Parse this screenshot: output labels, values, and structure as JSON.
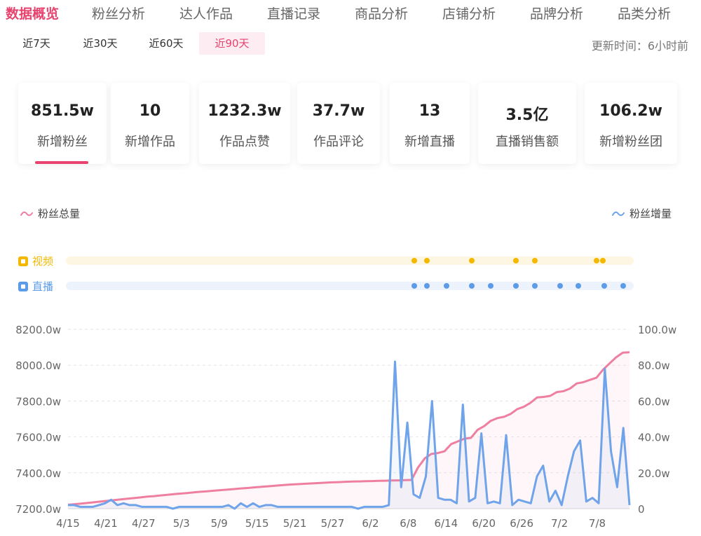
{
  "nav": {
    "tabs": [
      {
        "label": "数据概览",
        "active": true
      },
      {
        "label": "粉丝分析"
      },
      {
        "label": "达人作品"
      },
      {
        "label": "直播记录"
      },
      {
        "label": "商品分析"
      },
      {
        "label": "店铺分析"
      },
      {
        "label": "品牌分析"
      },
      {
        "label": "品类分析"
      }
    ]
  },
  "range": {
    "buttons": [
      "近7天",
      "近30天",
      "近60天",
      "近90天"
    ],
    "selected": "近90天"
  },
  "update_time": "更新时间：6小时前",
  "stats": [
    {
      "value": "851.5w",
      "label": "新增粉丝",
      "selected": true
    },
    {
      "value": "10",
      "label": "新增作品"
    },
    {
      "value": "1232.3w",
      "label": "作品点赞"
    },
    {
      "value": "37.7w",
      "label": "作品评论"
    },
    {
      "value": "13",
      "label": "新增直播"
    },
    {
      "value": "3.5亿",
      "label": "直播销售额"
    },
    {
      "value": "106.2w",
      "label": "新增粉丝团"
    }
  ],
  "legend": {
    "left": "粉丝总量",
    "right": "粉丝增量"
  },
  "tracks": {
    "video": {
      "label": "视频",
      "color": "#f5b800",
      "bar_color": "#fdf6e3"
    },
    "live": {
      "label": "直播",
      "color": "#5b9be8",
      "bar_color": "#edf3fc"
    }
  },
  "colors": {
    "accent": "#e8436f",
    "pink_line": "#ef7fa0",
    "blue_line": "#6fa3ea"
  },
  "chart_data": {
    "type": "line",
    "x_ticks": [
      "4/15",
      "4/21",
      "4/27",
      "5/3",
      "5/9",
      "5/15",
      "5/21",
      "5/27",
      "6/2",
      "6/8",
      "6/14",
      "6/20",
      "6/26",
      "7/2",
      "7/8"
    ],
    "y_left": {
      "ticks": [
        "7200.0w",
        "7400.0w",
        "7600.0w",
        "7800.0w",
        "8000.0w",
        "8200.0w"
      ],
      "min": 7200,
      "max": 8200
    },
    "y_right": {
      "ticks": [
        "0",
        "20.0w",
        "40.0w",
        "60.0w",
        "80.0w",
        "100.0w"
      ],
      "min": 0,
      "max": 100
    },
    "series": [
      {
        "name": "粉丝总量",
        "axis": "left",
        "values": [
          7222,
          7225,
          7228,
          7232,
          7236,
          7240,
          7244,
          7248,
          7252,
          7256,
          7259,
          7263,
          7267,
          7270,
          7274,
          7277,
          7281,
          7284,
          7287,
          7291,
          7294,
          7297,
          7300,
          7303,
          7306,
          7309,
          7312,
          7315,
          7318,
          7321,
          7324,
          7327,
          7330,
          7333,
          7335,
          7337,
          7339,
          7341,
          7343,
          7345,
          7347,
          7348,
          7350,
          7351,
          7352,
          7353,
          7354,
          7355,
          7356,
          7357,
          7358,
          7359,
          7360,
          7430,
          7480,
          7505,
          7510,
          7520,
          7560,
          7575,
          7590,
          7595,
          7640,
          7660,
          7690,
          7705,
          7712,
          7728,
          7755,
          7768,
          7790,
          7820,
          7823,
          7829,
          7850,
          7855,
          7870,
          7898,
          7905,
          7918,
          7930,
          7975,
          8010,
          8045,
          8070,
          8072
        ]
      },
      {
        "name": "粉丝增量",
        "axis": "right",
        "values": [
          2,
          2,
          1,
          1,
          1,
          2,
          3,
          5,
          2,
          3,
          2,
          2,
          1,
          1,
          1,
          1,
          1,
          0,
          1,
          1,
          1,
          1,
          1,
          1,
          1,
          1,
          2,
          0,
          3,
          1,
          3,
          1,
          2,
          2,
          1,
          1,
          1,
          1,
          1,
          1,
          1,
          1,
          1,
          1,
          1,
          1,
          1,
          0,
          1,
          1,
          1,
          1,
          2,
          82,
          12,
          48,
          8,
          6,
          18,
          60,
          6,
          5,
          5,
          3,
          58,
          4,
          6,
          42,
          3,
          4,
          3,
          41,
          2,
          5,
          4,
          3,
          18,
          24,
          4,
          10,
          2,
          18,
          32,
          38,
          4,
          6,
          3,
          78,
          32,
          12,
          45,
          2
        ]
      }
    ]
  }
}
